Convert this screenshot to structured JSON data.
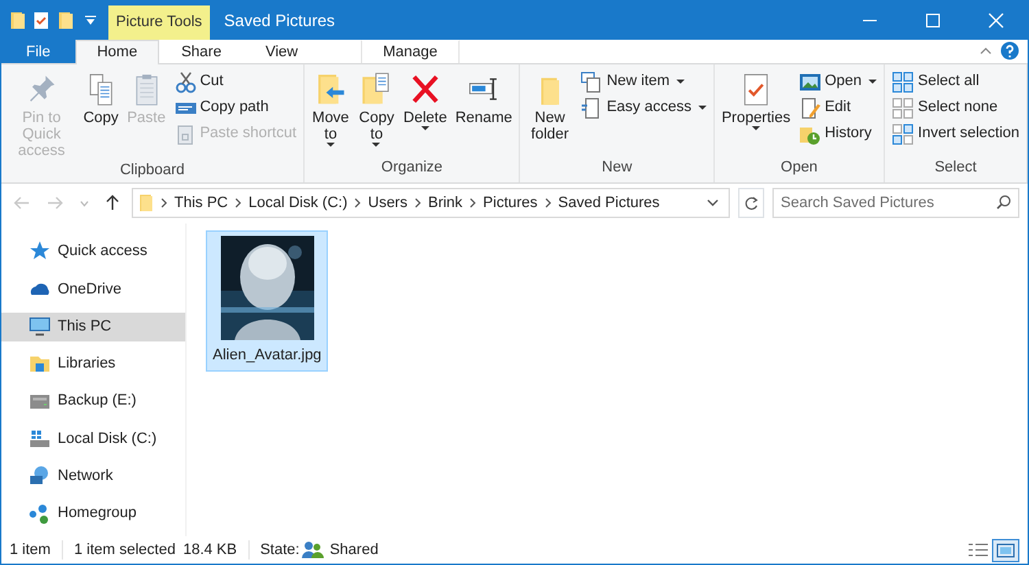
{
  "window": {
    "title": "Saved Pictures",
    "context_tab": "Picture Tools"
  },
  "ribbon_tabs": [
    {
      "label": "File",
      "kind": "file",
      "selected": false
    },
    {
      "label": "Home",
      "kind": "tab",
      "selected": true
    },
    {
      "label": "Share",
      "kind": "tab",
      "selected": false
    },
    {
      "label": "View",
      "kind": "tab",
      "selected": false
    },
    {
      "label": "Manage",
      "kind": "context",
      "selected": false
    }
  ],
  "ribbon_groups": [
    {
      "label": "Clipboard",
      "commands": [
        {
          "label": "Pin to Quick access",
          "kind": "large",
          "disabled": true,
          "dropdown": false
        },
        {
          "label": "Copy",
          "kind": "large",
          "disabled": false,
          "dropdown": false
        },
        {
          "label": "Paste",
          "kind": "large",
          "disabled": true,
          "dropdown": false
        },
        {
          "label": "Cut",
          "kind": "small",
          "disabled": false,
          "dropdown": false
        },
        {
          "label": "Copy path",
          "kind": "small",
          "disabled": false,
          "dropdown": false
        },
        {
          "label": "Paste shortcut",
          "kind": "small",
          "disabled": true,
          "dropdown": false
        }
      ]
    },
    {
      "label": "Organize",
      "commands": [
        {
          "label": "Move to",
          "kind": "large",
          "disabled": false,
          "dropdown": true
        },
        {
          "label": "Copy to",
          "kind": "large",
          "disabled": false,
          "dropdown": true
        },
        {
          "label": "Delete",
          "kind": "large",
          "disabled": false,
          "dropdown": true
        },
        {
          "label": "Rename",
          "kind": "large",
          "disabled": false,
          "dropdown": false
        }
      ]
    },
    {
      "label": "New",
      "commands": [
        {
          "label": "New folder",
          "kind": "large",
          "disabled": false,
          "dropdown": false
        },
        {
          "label": "New item",
          "kind": "small",
          "disabled": false,
          "dropdown": true
        },
        {
          "label": "Easy access",
          "kind": "small",
          "disabled": false,
          "dropdown": true
        }
      ]
    },
    {
      "label": "Open",
      "commands": [
        {
          "label": "Properties",
          "kind": "large",
          "disabled": false,
          "dropdown": true
        },
        {
          "label": "Open",
          "kind": "small",
          "disabled": false,
          "dropdown": true
        },
        {
          "label": "Edit",
          "kind": "small",
          "disabled": false,
          "dropdown": false
        },
        {
          "label": "History",
          "kind": "small",
          "disabled": false,
          "dropdown": false
        }
      ]
    },
    {
      "label": "Select",
      "commands": [
        {
          "label": "Select all",
          "kind": "small",
          "disabled": false,
          "dropdown": false
        },
        {
          "label": "Select none",
          "kind": "small",
          "disabled": false,
          "dropdown": false
        },
        {
          "label": "Invert selection",
          "kind": "small",
          "disabled": false,
          "dropdown": false
        }
      ]
    }
  ],
  "address_bar": {
    "back_disabled": true,
    "forward_disabled": true,
    "path": [
      "This PC",
      "Local Disk (C:)",
      "Users",
      "Brink",
      "Pictures",
      "Saved Pictures"
    ]
  },
  "search": {
    "placeholder": "Search Saved Pictures"
  },
  "navigation_pane": [
    {
      "label": "Quick access",
      "selected": false
    },
    {
      "label": "OneDrive",
      "selected": false
    },
    {
      "label": "This PC",
      "selected": true
    },
    {
      "label": "Libraries",
      "selected": false
    },
    {
      "label": "Backup (E:)",
      "selected": false
    },
    {
      "label": "Local Disk (C:)",
      "selected": false
    },
    {
      "label": "Network",
      "selected": false
    },
    {
      "label": "Homegroup",
      "selected": false
    }
  ],
  "files": [
    {
      "name": "Alien_Avatar.jpg",
      "kind": "picture",
      "selected": true
    }
  ],
  "status_bar": {
    "item_count": "1 item",
    "selection": "1 item selected",
    "size": "18.4 KB",
    "state_label": "State:",
    "state": "Shared",
    "views": [
      {
        "selected": false
      },
      {
        "selected": true
      }
    ]
  }
}
